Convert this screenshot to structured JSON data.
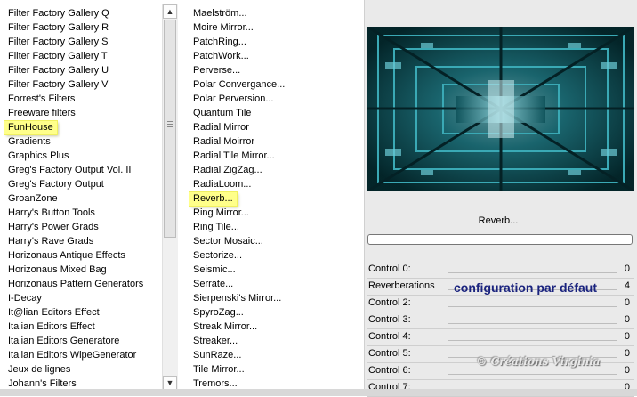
{
  "left_list": {
    "items": [
      "Filter Factory Gallery Q",
      "Filter Factory Gallery R",
      "Filter Factory Gallery S",
      "Filter Factory Gallery T",
      "Filter Factory Gallery U",
      "Filter Factory Gallery V",
      "Forrest's Filters",
      "Freeware filters",
      "FunHouse",
      "Gradients",
      "Graphics Plus",
      "Greg's Factory Output Vol. II",
      "Greg's Factory Output",
      "GroanZone",
      "Harry's Button Tools",
      "Harry's Power Grads",
      "Harry's Rave Grads",
      "Horizonaus Antique Effects",
      "Horizonaus Mixed Bag",
      "Horizonaus Pattern Generators",
      "I-Decay",
      "It@lian Editors Effect",
      "Italian Editors Effect",
      "Italian Editors Generatore",
      "Italian Editors WipeGenerator",
      "Jeux de lignes",
      "Johann's Filters"
    ],
    "highlighted_index": 8
  },
  "mid_list": {
    "items": [
      "Maelström...",
      "Moire Mirror...",
      "PatchRing...",
      "PatchWork...",
      "Perverse...",
      "Polar Convergance...",
      "Polar Perversion...",
      "Quantum Tile",
      "Radial Mirror",
      "Radial Moirror",
      "Radial Tile Mirror...",
      "Radial ZigZag...",
      "RadiaLoom...",
      "Reverb...",
      "Ring Mirror...",
      "Ring Tile...",
      "Sector Mosaic...",
      "Sectorize...",
      "Seismic...",
      "Serrate...",
      "Sierpenski's Mirror...",
      "SpyroZag...",
      "Streak Mirror...",
      "Streaker...",
      "SunRaze...",
      "Tile Mirror...",
      "Tremors..."
    ],
    "highlighted_index": 13
  },
  "filter_title": "Reverb...",
  "progress": 0,
  "controls": [
    {
      "name": "Control 0:",
      "value": "0"
    },
    {
      "name": "Reverberations",
      "value": "4"
    },
    {
      "name": "Control 2:",
      "value": "0"
    },
    {
      "name": "Control 3:",
      "value": "0"
    },
    {
      "name": "Control 4:",
      "value": "0"
    },
    {
      "name": "Control 5:",
      "value": "0"
    },
    {
      "name": "Control 6:",
      "value": "0"
    },
    {
      "name": "Control 7:",
      "value": "0"
    }
  ],
  "note": "configuration par défaut",
  "watermark": "© Créations Virginia",
  "scroll_up_icon": "arrow-up-icon",
  "scroll_down_icon": "arrow-down-icon"
}
